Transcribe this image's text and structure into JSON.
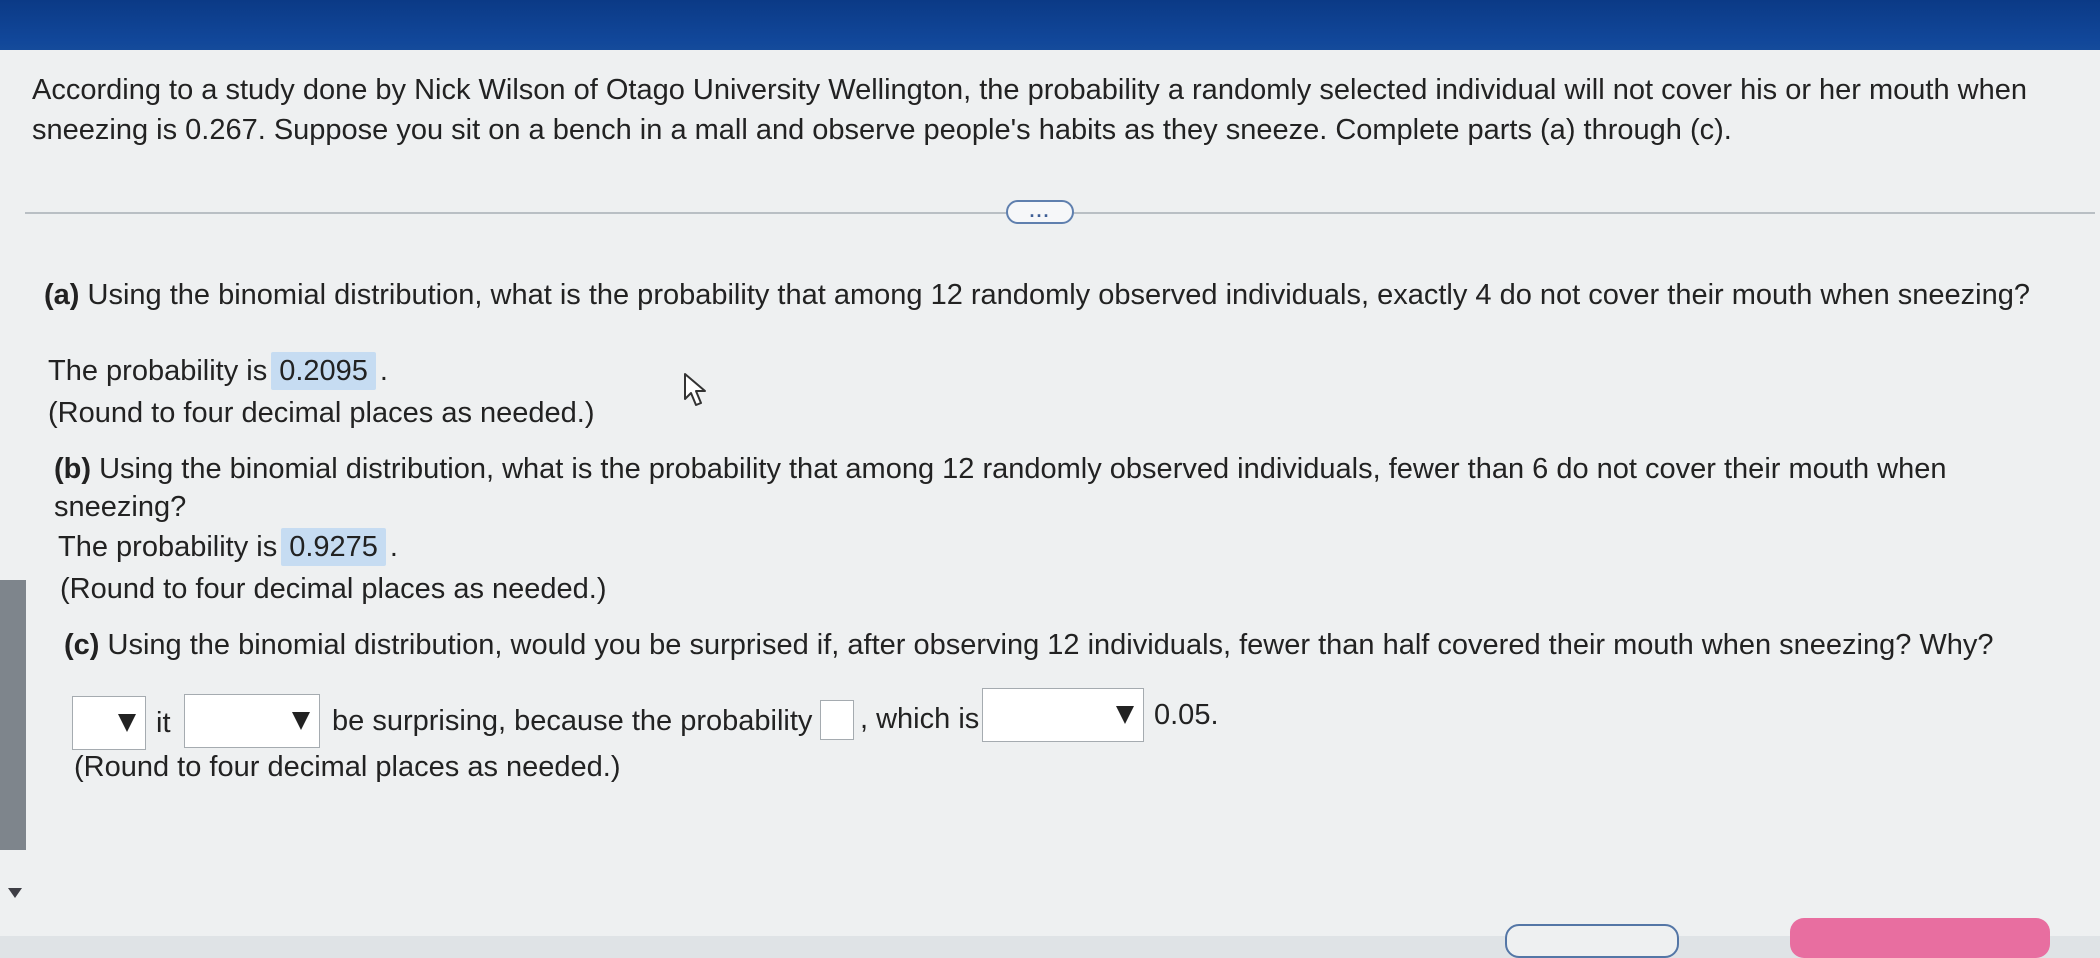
{
  "intro": "According to a study done by Nick Wilson of Otago University Wellington, the probability a randomly selected individual will not cover his or her mouth when sneezing is 0.267. Suppose you sit on a bench in a mall and observe people's habits as they sneeze. Complete parts (a) through (c).",
  "more_button_label": "...",
  "part_a": {
    "letter": "(a)",
    "question": "Using the binomial distribution, what is the probability that among 12 randomly observed individuals, exactly 4 do not cover their mouth when sneezing?",
    "answer_prefix": "The probability is",
    "answer_value": "0.2095",
    "answer_suffix": ".",
    "round_note": "(Round to four decimal places as needed.)"
  },
  "part_b": {
    "letter": "(b)",
    "question": "Using the binomial distribution, what is the probability that among 12 randomly observed individuals, fewer than 6 do not cover their mouth when sneezing?",
    "answer_prefix": "The probability is",
    "answer_value": "0.9275",
    "answer_suffix": ".",
    "round_note": "(Round to four decimal places as needed.)"
  },
  "part_c": {
    "letter": "(c)",
    "question": "Using the binomial distribution, would you be surprised if, after observing 12 individuals, fewer than half covered their mouth when sneezing? Why?",
    "text_it": "it",
    "text_be_surprising": "be surprising, because the probability is",
    "text_which_is": ", which is",
    "text_threshold": "0.05.",
    "dropdown1_value": "",
    "dropdown2_value": "",
    "probability_value": "",
    "dropdown3_value": "",
    "round_note": "(Round to four decimal places as needed.)"
  },
  "icons": {
    "cursor": "mouse-pointer-icon",
    "dropdown": "triangle-down-icon",
    "scroll_down": "scroll-down-icon"
  }
}
